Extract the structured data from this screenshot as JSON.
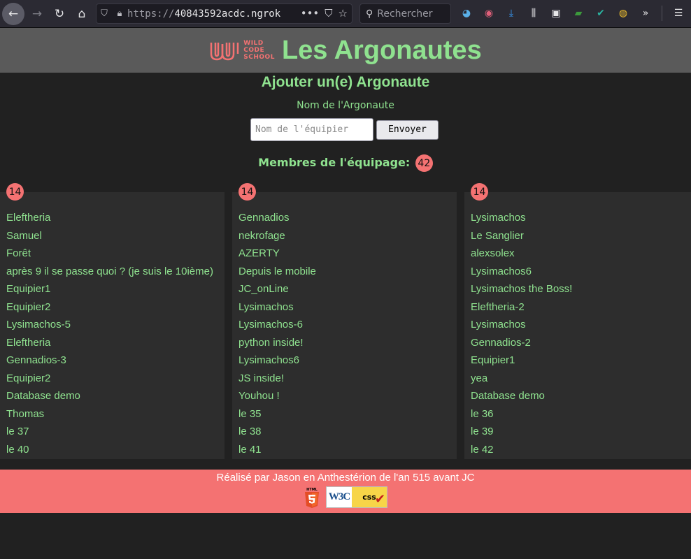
{
  "browser": {
    "url_scheme": "https://",
    "url_host": "40843592acdc.ngrok",
    "url_more": "•••",
    "search_placeholder": "Rechercher"
  },
  "header": {
    "logo_line1": "WILD",
    "logo_line2": "CODE",
    "logo_line3": "SCHOOL",
    "title": "Les Argonautes"
  },
  "form": {
    "title": "Ajouter un(e) Argonaute",
    "label": "Nom de l'Argonaute",
    "input_placeholder": "Nom de l'équipier",
    "input_value": "",
    "submit_label": "Envoyer"
  },
  "crew": {
    "title": "Membres de l'équipage:",
    "count": "42"
  },
  "columns": [
    {
      "count": "14",
      "members": [
        "Eleftheria",
        "Samuel",
        "Forêt",
        "après 9 il se passe quoi ? (je suis le 10ième)",
        "Equipier1",
        "Equipier2",
        "Lysimachos-5",
        "Eleftheria",
        "Gennadios-3",
        "Equipier2",
        "Database demo",
        "Thomas",
        "le 37",
        "le 40"
      ]
    },
    {
      "count": "14",
      "members": [
        "Gennadios",
        "nekrofage",
        "AZERTY",
        "Depuis le mobile",
        "JC_onLine",
        "Lysimachos",
        "Lysimachos-6",
        "python inside!",
        "Lysimachos6",
        "JS inside!",
        "Youhou !",
        "le 35",
        "le 38",
        "le 41"
      ]
    },
    {
      "count": "14",
      "members": [
        "Lysimachos",
        "Le Sanglier",
        "alexsolex",
        "Lysimachos6",
        "Lysimachos the Boss!",
        "Eleftheria-2",
        "Lysimachos",
        "Gennadios-2",
        "Equipier1",
        "yea",
        "Database demo",
        "le 36",
        "le 39",
        "le 42"
      ]
    }
  ],
  "footer": {
    "text": "Réalisé par Jason en Anthestérion de l'an 515 avant JC",
    "html5_badge": "HTML",
    "w3c_badge_left": "W3C",
    "w3c_badge_right": "css"
  },
  "colors": {
    "accent_green": "#8fe28f",
    "accent_red": "#f47272",
    "background": "#212121",
    "header_bg": "#5a5a5a",
    "column_bg": "#2d2d2d"
  }
}
